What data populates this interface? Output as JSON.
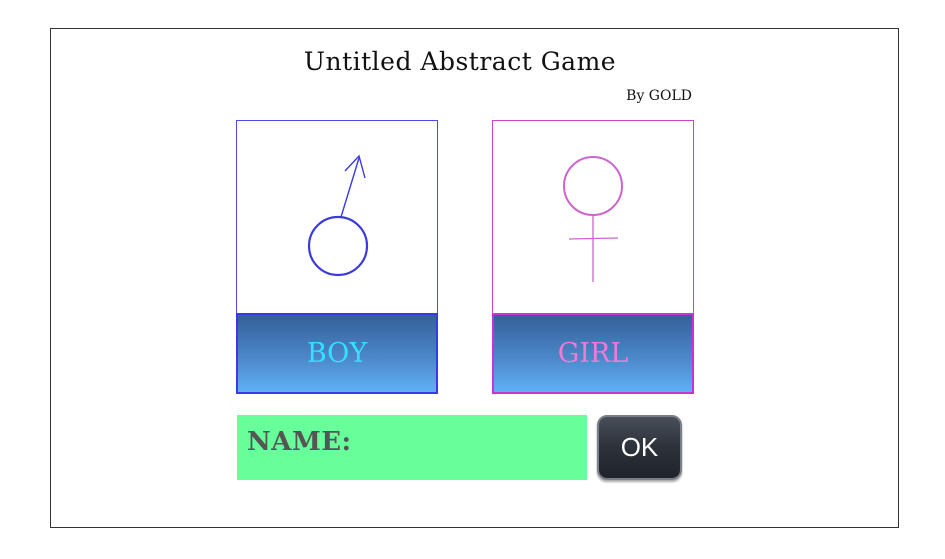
{
  "game": {
    "title": "Untitled Abstract Game",
    "byline": "By GOLD"
  },
  "cards": {
    "boy": {
      "label": "BOY",
      "icon": "male-symbol-icon",
      "color": "#3a3ae0",
      "label_color": "#33e0ff"
    },
    "girl": {
      "label": "GIRL",
      "icon": "female-symbol-icon",
      "color": "#cc66cc",
      "label_color": "#f07ad8"
    }
  },
  "name_field": {
    "label": "NAME:",
    "value": "",
    "background": "#66ff99"
  },
  "ok_button": {
    "label": "OK"
  }
}
